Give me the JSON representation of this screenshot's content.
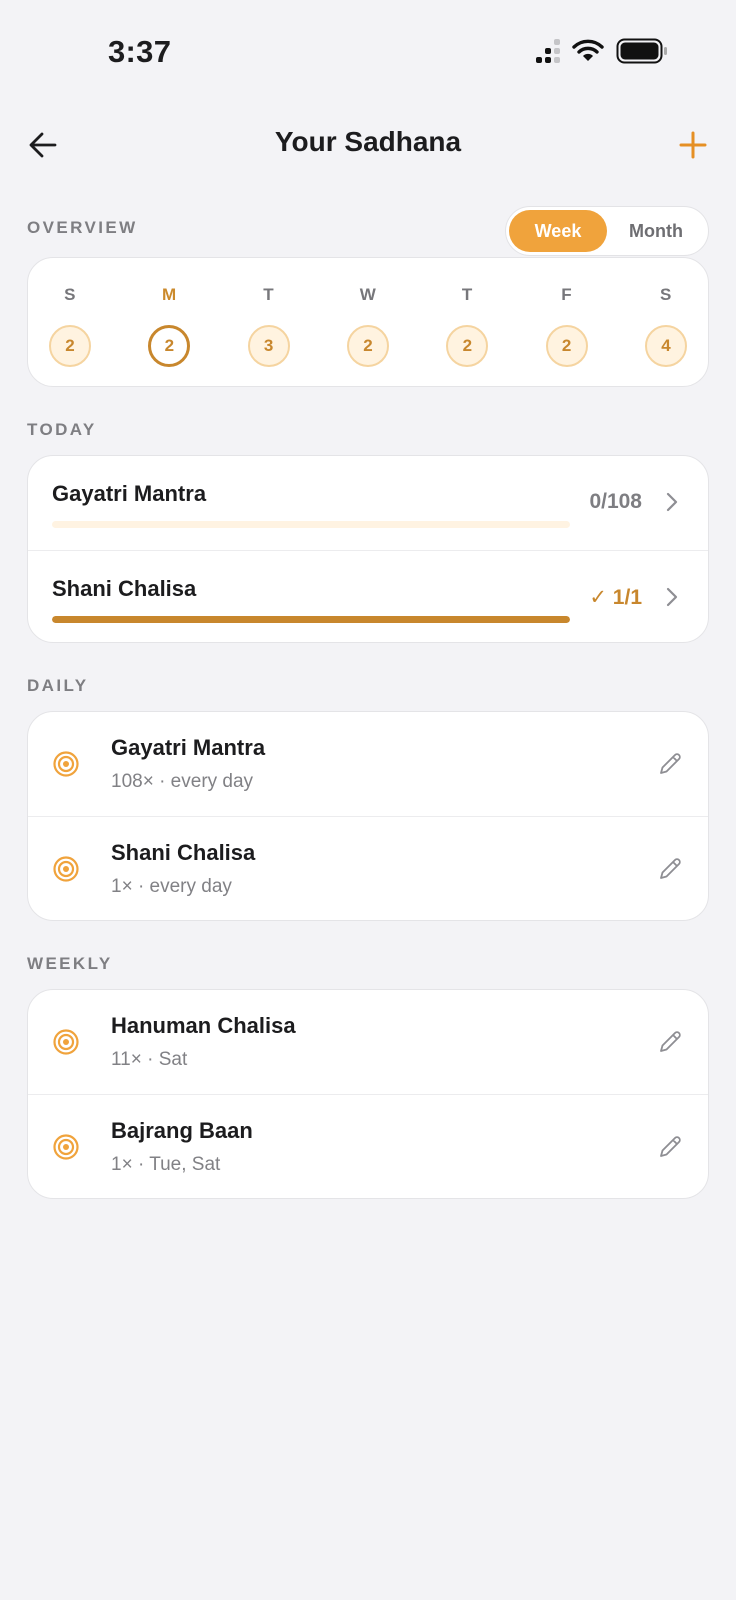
{
  "status": {
    "time": "3:37"
  },
  "header": {
    "title": "Your Sadhana"
  },
  "overview": {
    "label": "OVERVIEW",
    "toggle": {
      "week": "Week",
      "month": "Month",
      "selected": "Week"
    },
    "days": [
      {
        "letter": "S",
        "count": "2",
        "current": false
      },
      {
        "letter": "M",
        "count": "2",
        "current": true
      },
      {
        "letter": "T",
        "count": "3",
        "current": false
      },
      {
        "letter": "W",
        "count": "2",
        "current": false
      },
      {
        "letter": "T",
        "count": "2",
        "current": false
      },
      {
        "letter": "F",
        "count": "2",
        "current": false
      },
      {
        "letter": "S",
        "count": "4",
        "current": false
      }
    ]
  },
  "today": {
    "label": "TODAY",
    "items": [
      {
        "name": "Gayatri Mantra",
        "count": "0/108",
        "progress": 0
      },
      {
        "name": "Shani Chalisa",
        "count": "✓ 1/1",
        "progress": 1
      }
    ]
  },
  "daily": {
    "label": "DAILY",
    "items": [
      {
        "title": "Gayatri Mantra",
        "subtitle": "108× · every day"
      },
      {
        "title": "Shani Chalisa",
        "subtitle": "1× · every day"
      }
    ]
  },
  "weekly": {
    "label": "WEEKLY",
    "items": [
      {
        "title": "Hanuman Chalisa",
        "subtitle": "11× · Sat"
      },
      {
        "title": "Bajrang Baan",
        "subtitle": "1× · Tue, Sat"
      }
    ]
  },
  "icons": {
    "back": "arrow-left-icon",
    "add": "plus-icon",
    "chevron": "chevron-right-icon",
    "practice": "target-icon",
    "edit": "pencil-icon"
  },
  "colors": {
    "accent": "#f0a33c",
    "accent_dark": "#c8872d",
    "background": "#f3f3f6"
  }
}
